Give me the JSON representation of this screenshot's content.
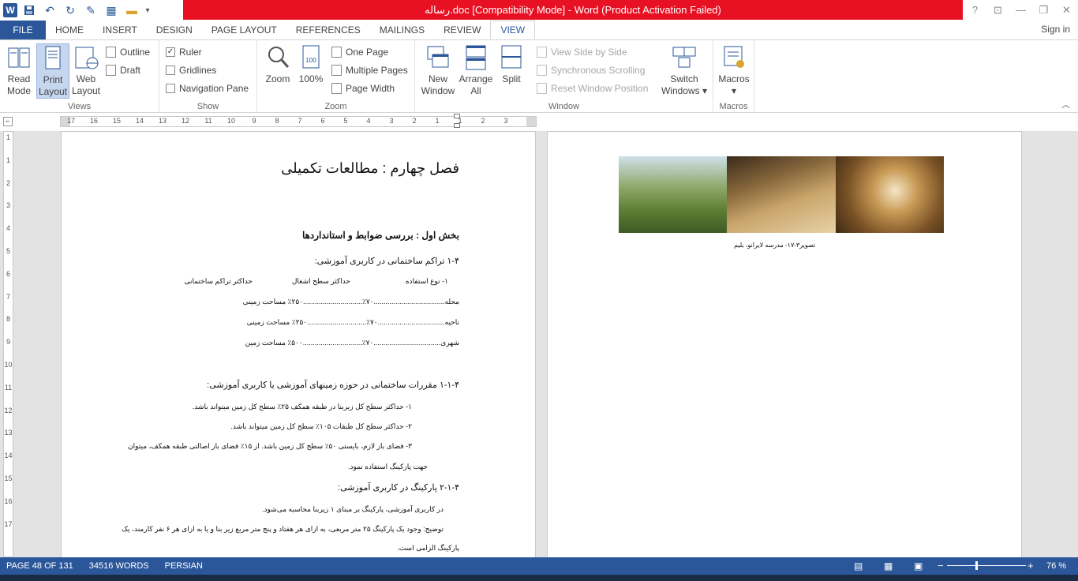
{
  "titlebar": {
    "title": "رساله.doc [Compatibility Mode] -  Word (Product Activation Failed)",
    "help": "?",
    "controls": [
      "⊡",
      "—",
      "❐",
      "✕"
    ]
  },
  "tabs": [
    {
      "label": "FILE"
    },
    {
      "label": "HOME"
    },
    {
      "label": "INSERT"
    },
    {
      "label": "DESIGN"
    },
    {
      "label": "PAGE LAYOUT"
    },
    {
      "label": "REFERENCES"
    },
    {
      "label": "MAILINGS"
    },
    {
      "label": "REVIEW"
    },
    {
      "label": "VIEW"
    }
  ],
  "signin": "Sign in",
  "ribbon": {
    "views": {
      "label": "Views",
      "read_mode": [
        "Read",
        "Mode"
      ],
      "print_layout": [
        "Print",
        "Layout"
      ],
      "web_layout": [
        "Web",
        "Layout"
      ],
      "outline": "Outline",
      "draft": "Draft"
    },
    "show": {
      "label": "Show",
      "ruler": "Ruler",
      "ruler_checked": "✓",
      "gridlines": "Gridlines",
      "navigation_pane": "Navigation Pane"
    },
    "zoom": {
      "label": "Zoom",
      "zoom": "Zoom",
      "hundred": "100%",
      "hundred_icon": "100",
      "one_page": "One Page",
      "multiple_pages": "Multiple Pages",
      "page_width": "Page Width"
    },
    "window": {
      "label": "Window",
      "new_window": [
        "New",
        "Window"
      ],
      "arrange_all": [
        "Arrange",
        "All"
      ],
      "split": "Split",
      "view_side_by_side": "View Side by Side",
      "synchronous_scrolling": "Synchronous Scrolling",
      "reset_window_position": "Reset Window Position",
      "switch_windows": [
        "Switch",
        "Windows ▾"
      ]
    },
    "macros": {
      "label": "Macros",
      "macros": "Macros",
      "arrow": "▾"
    }
  },
  "ruler_numbers": [
    "17",
    "16",
    "15",
    "14",
    "13",
    "12",
    "11",
    "10",
    "9",
    "8",
    "7",
    "6",
    "5",
    "4",
    "3",
    "2",
    "1",
    "1",
    "2",
    "3"
  ],
  "vruler_numbers": [
    "1",
    "1",
    "2",
    "3",
    "4",
    "5",
    "6",
    "7",
    "8",
    "9",
    "10",
    "11",
    "12",
    "13",
    "14",
    "15",
    "16",
    "17"
  ],
  "page_left": {
    "heading": "فصل چهارم : مطالعات تکمیلی",
    "section1": "بخش اول : بررسی ضوابط و استانداردها",
    "sub1": "۱-۴  تراکم ساختمانی در کاربری آموزشی:",
    "table_header": {
      "c1": "۱-     نوع استفاده",
      "c2": "حداکثر سطح اشغال",
      "c3": "حداکثر تراکم ساختمانی"
    },
    "rows": [
      "محله....................................۷۰٪..............................۲۵۰٪ مساحت زمینی",
      "ناحیه..................................۷۰٪..............................۲۵۰٪  مساحت زمینی",
      "شهری..................................۷۰٪..............................۵۰۰٪ مساحت زمین"
    ],
    "sub2": "۱-۱-۴  مقررات ساختمانی در حوزه زمینهای آموزشی یا کاربری آموزشی:",
    "rule1": "۱-  حداکثر سطح کل زیربنا در طبقه همکف ۲۵٪ سطح کل زمین میتواند باشد.",
    "rule2": "۲-  حداکثر سطح کل طبقات ۱۰۵٪ سطح کل زمین میتواند باشد.",
    "rule3": "۳-  فضای باز لازم، بایستی ۵۰٪ سطح کل زمین باشد. از ۱۵٪ فضای باز اصالتی طبقه همکف، میتوان",
    "rule3b": "جهت پارکینگ استفاده نمود.",
    "sub3": "۲-۱-۴ پارکینگ در کاربری آموزشی:",
    "park1": "در کاربری آموزشی، پارکینگ بر مبنای ۱ زیربنا محاسبه می‌شود.",
    "park2": "توضیح: وجود یک پارکینگ ۲۵ متر مربعی، به ازای هر هفتاد و پنج متر مربع زیر بنا و یا به ازای هر ۶ نفر کارمند، یک",
    "park3": "پارکینگ الزامی است."
  },
  "page_right": {
    "caption": "تصویر۳-۱۷- مدرسه لایرانو، بلیم"
  },
  "statusbar": {
    "page": "PAGE 48 OF 131",
    "words": "34516 WORDS",
    "language": "PERSIAN",
    "minus": "−",
    "plus": "+",
    "zoom": "76 %"
  },
  "colors": {
    "accent": "#2b579a",
    "activation_red": "#e81123"
  }
}
